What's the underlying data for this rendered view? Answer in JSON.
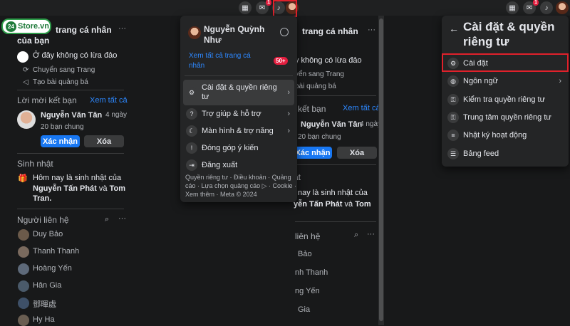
{
  "brand": {
    "logo_num": "24",
    "logo_text": "Store.vn"
  },
  "left": {
    "pages_title_1": "trang cá nhân",
    "pages_title_2": "của bạn",
    "page_name": "Ở đây không có lừa đảo",
    "switch_label": "Chuyển sang Trang",
    "ad_label": "Tạo bài quảng bá",
    "friend_req_title": "Lời mời kết bạn",
    "see_all": "Xem tất cả",
    "friend_name": "Nguyễn Văn Tân",
    "friend_time": "4 ngày",
    "mutual": "20 bạn chung",
    "confirm": "Xác nhận",
    "delete": "Xóa",
    "birthday_title": "Sinh nhật",
    "bday_line1": "Hôm nay là sinh nhật của",
    "bday_name1": "Nguyễn Tấn Phát",
    "bday_and": "và",
    "bday_name2": "Tom",
    "bday_name3": "Tran.",
    "contacts_title": "Người liên hệ",
    "contacts": [
      "Duy Bảo",
      "Thanh Thanh",
      "Hoàng Yến",
      "Hân Gia",
      "鄧暉處",
      "Hy Ha"
    ]
  },
  "account_menu": {
    "user_name_1": "Nguyễn Quỳnh",
    "user_name_2": "Như",
    "see_pages_1": "Xem tất cả trang cá",
    "see_pages_2": "nhân",
    "pages_badge": "50+",
    "items": [
      {
        "label_1": "Cài đặt & quyền riêng",
        "label_2": "tư",
        "icon": "gear-icon"
      },
      {
        "label_1": "Trợ giúp & hỗ trợ",
        "icon": "help-icon"
      },
      {
        "label_1": "Màn hình & trợ năng",
        "icon": "moon-icon"
      },
      {
        "label_1": "Đóng góp ý kiến",
        "icon": "feedback-icon"
      },
      {
        "label_1": "Đăng xuất",
        "icon": "logout-icon"
      }
    ],
    "footer_1": "Quyền riêng tư · Điều khoản · Quảng",
    "footer_2": "cáo · Lựa chọn quảng cáo ▷ · Cookie ·",
    "footer_3": "Xem thêm · Meta © 2024"
  },
  "middle": {
    "pages_title": "trang cá nhân",
    "page_name": "y không có lừa đảo",
    "switch_label": "yển sang Trang",
    "ad_label": "bài quảng bá",
    "friend_req_title": "kết bạn",
    "see_all": "Xem tất cả",
    "friend_name": "Nguyễn Văn Tân",
    "friend_time": "4 ngày",
    "mutual": "20 bạn chung",
    "confirm": "Xác nhận",
    "delete": "Xóa",
    "birthday_title": "ật",
    "bday_line1": "nay là sinh nhật của",
    "bday_names": "yễn Tấn Phát",
    "bday_and": "và",
    "bday_name2": "Tom",
    "contacts_title": "liên hệ",
    "contacts": [
      "Bảo",
      "nh Thanh",
      "ng Yến",
      "Gia"
    ]
  },
  "settings_panel": {
    "back": "←",
    "title_1": "Cài đặt & quyền",
    "title_2": "riêng tư",
    "items": [
      {
        "label": "Cài đặt",
        "icon": "gear-icon"
      },
      {
        "label": "Ngôn ngữ",
        "icon": "globe-icon"
      },
      {
        "label": "Kiểm tra quyền riêng tư",
        "icon": "lock-check-icon"
      },
      {
        "label": "Trung tâm quyền riêng tư",
        "icon": "lock-icon"
      },
      {
        "label": "Nhật ký hoạt động",
        "icon": "list-icon"
      },
      {
        "label": "Bảng feed",
        "icon": "sliders-icon"
      }
    ]
  },
  "topbar": {
    "grid": "⋮⋮",
    "messenger": "✉",
    "bell": "🔔",
    "messenger_badge": "1"
  }
}
